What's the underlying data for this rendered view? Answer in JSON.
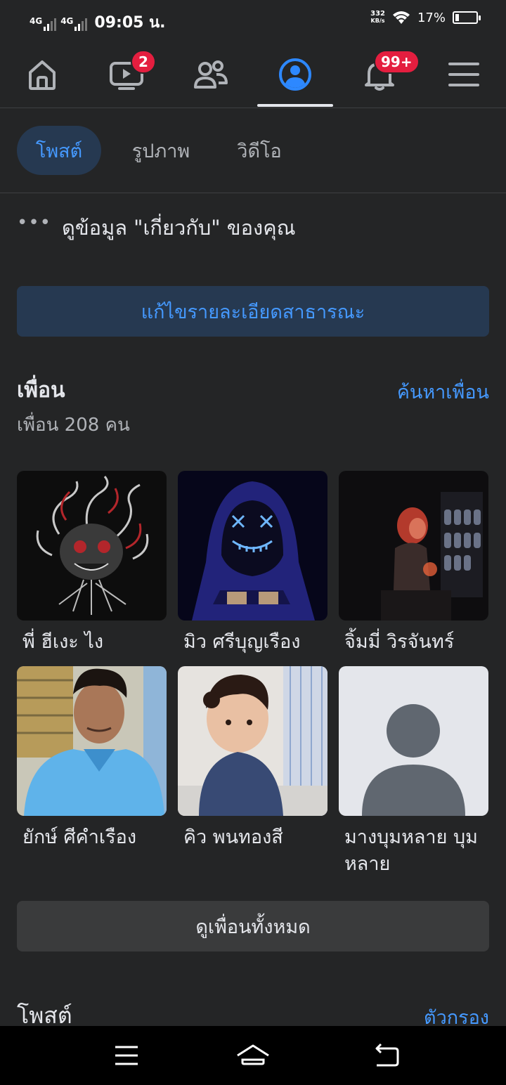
{
  "status_bar": {
    "network_1": "4G",
    "network_2": "4G",
    "time": "09:05 น.",
    "speed_value": "332",
    "speed_unit": "KB/s",
    "battery_percent": "17%",
    "battery_level": 0.17
  },
  "top_nav": {
    "items": [
      {
        "icon": "home-icon"
      },
      {
        "icon": "watch-icon",
        "badge": "2"
      },
      {
        "icon": "friends-icon"
      },
      {
        "icon": "profile-icon",
        "active": true
      },
      {
        "icon": "bell-icon",
        "badge": "99+"
      },
      {
        "icon": "menu-icon"
      }
    ]
  },
  "tabs": [
    {
      "label": "โพสต์",
      "active": true
    },
    {
      "label": "รูปภาพ"
    },
    {
      "label": "วิดีโอ"
    }
  ],
  "about": {
    "more_icon": "more-dots-icon",
    "text": "ดูข้อมูล \"เกี่ยวกับ\" ของคุณ"
  },
  "edit_public_details": "แก้ไขรายละเอียดสาธารณะ",
  "friends": {
    "title": "เพื่อน",
    "find_link": "ค้นหาเพื่อน",
    "count_text": "เพื่อน 208 คน",
    "list": [
      {
        "name": "พี่ ฮีเงะ ไง"
      },
      {
        "name": "มิว ศรีบุญเรือง"
      },
      {
        "name": "จิ้มมี่ วิรจันทร์"
      },
      {
        "name": "ยักษ์ ศีคำเรือง"
      },
      {
        "name": "คิว พนทองสี"
      },
      {
        "name": "มางบุมหลาย บุม หลาย"
      }
    ],
    "see_all": "ดูเพื่อนทั้งหมด"
  },
  "posts": {
    "title": "โพสต์",
    "filter_link": "ตัวกรอง"
  },
  "system_nav": {
    "items": [
      "recents-icon",
      "home-icon",
      "back-icon"
    ]
  },
  "colors": {
    "background": "#242526",
    "accent": "#4599ff",
    "accent_bg": "#263951",
    "badge": "#e41e3f"
  }
}
